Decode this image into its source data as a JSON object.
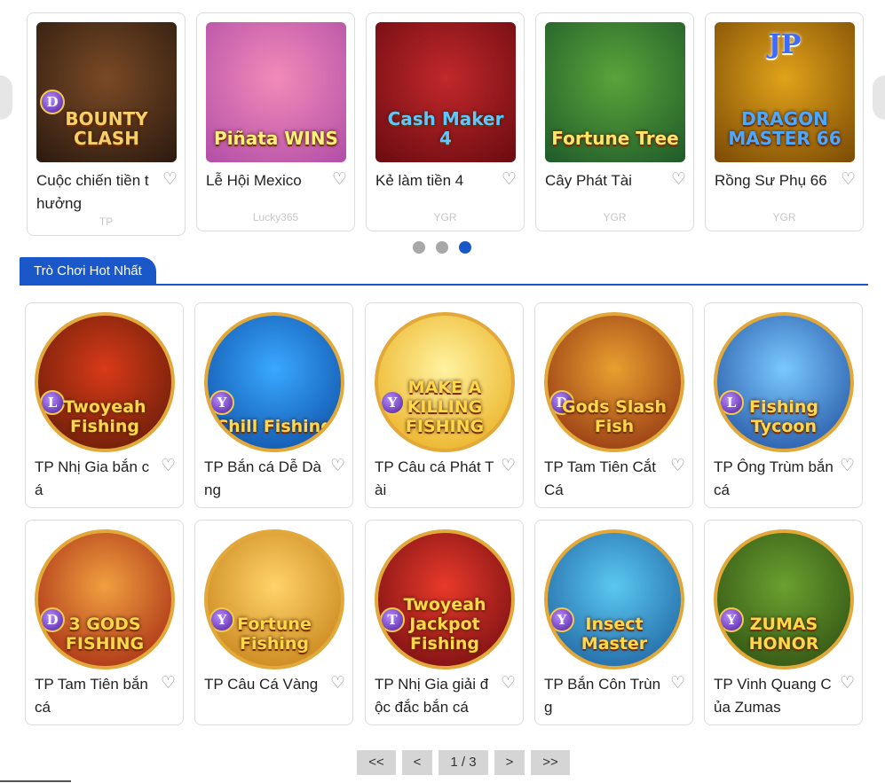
{
  "carousel": {
    "cards": [
      {
        "name": "Cuộc chiến tiền thưởng",
        "provider": "TP",
        "thumb_text": "BOUNTY CLASH",
        "badge": "D",
        "bg": [
          "#7a4a25",
          "#2b1a10"
        ],
        "text_color": "#f4d06a"
      },
      {
        "name": "Lễ Hội Mexico",
        "provider": "Lucky365",
        "thumb_text": "Piñata WINS",
        "badge": "",
        "bg": [
          "#f28ab8",
          "#b24ea8"
        ],
        "text_color": "#fff07a"
      },
      {
        "name": "Kẻ làm tiền 4",
        "provider": "YGR",
        "thumb_text": "Cash Maker 4",
        "badge": "",
        "bg": [
          "#c1282b",
          "#6a0b10"
        ],
        "text_color": "#5cc8ff"
      },
      {
        "name": "Cây Phát Tài",
        "provider": "YGR",
        "thumb_text": "Fortune Tree",
        "badge": "",
        "bg": [
          "#5aa43a",
          "#1f5a2a"
        ],
        "text_color": "#ffe56a"
      },
      {
        "name": "Rồng Sư Phụ 66",
        "provider": "YGR",
        "thumb_text": "DRAGON MASTER 66",
        "badge": "JP",
        "bg": [
          "#e0a21a",
          "#7a4a05"
        ],
        "text_color": "#4aa8ff"
      }
    ],
    "dots": [
      {
        "active": false
      },
      {
        "active": false
      },
      {
        "active": true
      }
    ]
  },
  "section": {
    "title": "Trò Chơi Hot Nhất"
  },
  "games": [
    {
      "name": "TP Nhị Gia bắn cá",
      "thumb_text": "Twoyeah Fishing",
      "badge": "L",
      "bg": [
        "#d83a18",
        "#5a1a08"
      ]
    },
    {
      "name": "TP Bắn cá Dễ Dàng",
      "thumb_text": "Chill Fishing",
      "badge": "Y",
      "bg": [
        "#3aa8ff",
        "#0b4aa0"
      ]
    },
    {
      "name": "TP Câu cá Phát Tài",
      "thumb_text": "MAKE A KILLING FISHING",
      "badge": "Y",
      "bg": [
        "#fff3a0",
        "#e8a814"
      ]
    },
    {
      "name": "TP Tam Tiên Cắt Cá",
      "thumb_text": "Gods Slash Fish",
      "badge": "D",
      "bg": [
        "#e8a030",
        "#8a2a10"
      ]
    },
    {
      "name": "TP Ông Trùm bắn cá",
      "thumb_text": "Fishing Tycoon",
      "badge": "L",
      "bg": [
        "#7ac8ff",
        "#1c4a9a"
      ]
    },
    {
      "name": "TP Tam Tiên bắn cá",
      "thumb_text": "3 GODS FISHING",
      "badge": "D",
      "bg": [
        "#f0a040",
        "#a02010"
      ]
    },
    {
      "name": "TP Câu Cá Vàng",
      "thumb_text": "Fortune Fishing",
      "badge": "Y",
      "bg": [
        "#ffd36a",
        "#c07a10"
      ]
    },
    {
      "name": "TP Nhị Gia giải độc đắc bắn cá",
      "thumb_text": "Twoyeah Jackpot Fishing",
      "badge": "T",
      "bg": [
        "#e83a2a",
        "#6a0a10"
      ]
    },
    {
      "name": "TP Bắn Côn Trùng",
      "thumb_text": "Insect Master",
      "badge": "Y",
      "bg": [
        "#5ac8f0",
        "#1a5a9a"
      ]
    },
    {
      "name": "TP Vinh Quang Của Zumas",
      "thumb_text": "ZUMAS HONOR",
      "badge": "Y",
      "bg": [
        "#6aa030",
        "#2a4a10"
      ]
    }
  ],
  "pagination": {
    "first": "<<",
    "prev": "<",
    "info": "1 / 3",
    "next": ">",
    "last": ">>"
  },
  "colors": {
    "accent": "#1a57c9",
    "heart": "#888888",
    "provider": "#c6c6c6"
  },
  "icons": {
    "favorite": "heart-outline-icon"
  }
}
